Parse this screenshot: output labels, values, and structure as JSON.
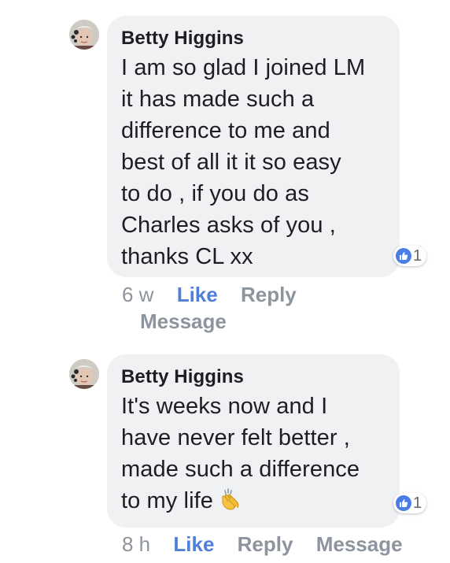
{
  "comments": [
    {
      "author": "Betty Higgins",
      "text": "I am so glad I joined LM\nit has made such a\ndifference to me and\nbest of all it it so easy\nto do , if you do as\nCharles asks of you ,\nthanks CL xx",
      "reaction_count": "1",
      "time": "6 w",
      "like_label": "Like",
      "reply_label": "Reply",
      "message_label": "Message"
    },
    {
      "author": "Betty Higgins",
      "text": "It's weeks now and I\nhave never felt better ,\nmade such a difference\nto my life",
      "emoji": "clapping-hands",
      "reaction_count": "1",
      "time": "8 h",
      "like_label": "Like",
      "reply_label": "Reply",
      "message_label": "Message"
    }
  ],
  "colors": {
    "bubble": "#f0f1f3",
    "like_blue": "#4f7fd6",
    "meta_gray": "#8d949e"
  }
}
